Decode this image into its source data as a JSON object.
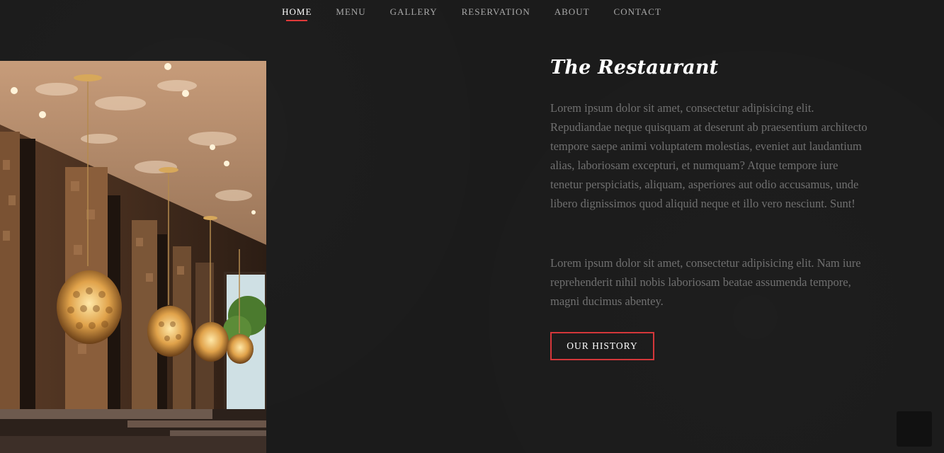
{
  "nav": {
    "items": [
      {
        "label": "HOME",
        "active": true
      },
      {
        "label": "MENU",
        "active": false
      },
      {
        "label": "GALLERY",
        "active": false
      },
      {
        "label": "RESERVATION",
        "active": false
      },
      {
        "label": "ABOUT",
        "active": false
      },
      {
        "label": "CONTACT",
        "active": false
      }
    ]
  },
  "about": {
    "title": "The Restaurant",
    "paragraph1": "Lorem ipsum dolor sit amet, consectetur adipisicing elit. Repudiandae neque quisquam at deserunt ab praesentium architecto tempore saepe animi voluptatem molestias, eveniet aut laudantium alias, laboriosam excepturi, et numquam? Atque tempore iure tenetur perspiciatis, aliquam, asperiores aut odio accusamus, unde libero dignissimos quod aliquid neque et illo vero nesciunt. Sunt!",
    "paragraph2": "Lorem ipsum dolor sit amet, consectetur adipisicing elit. Nam iure reprehenderit nihil nobis laboriosam beatae assumenda tempore, magni ducimus abentey.",
    "button_label": "OUR HISTORY"
  },
  "colors": {
    "background": "#1b1b1b",
    "accent": "#e03a3a",
    "title": "#ffffff",
    "body_text": "#707070"
  },
  "icons": {
    "back_to_top": "back-to-top-button"
  }
}
